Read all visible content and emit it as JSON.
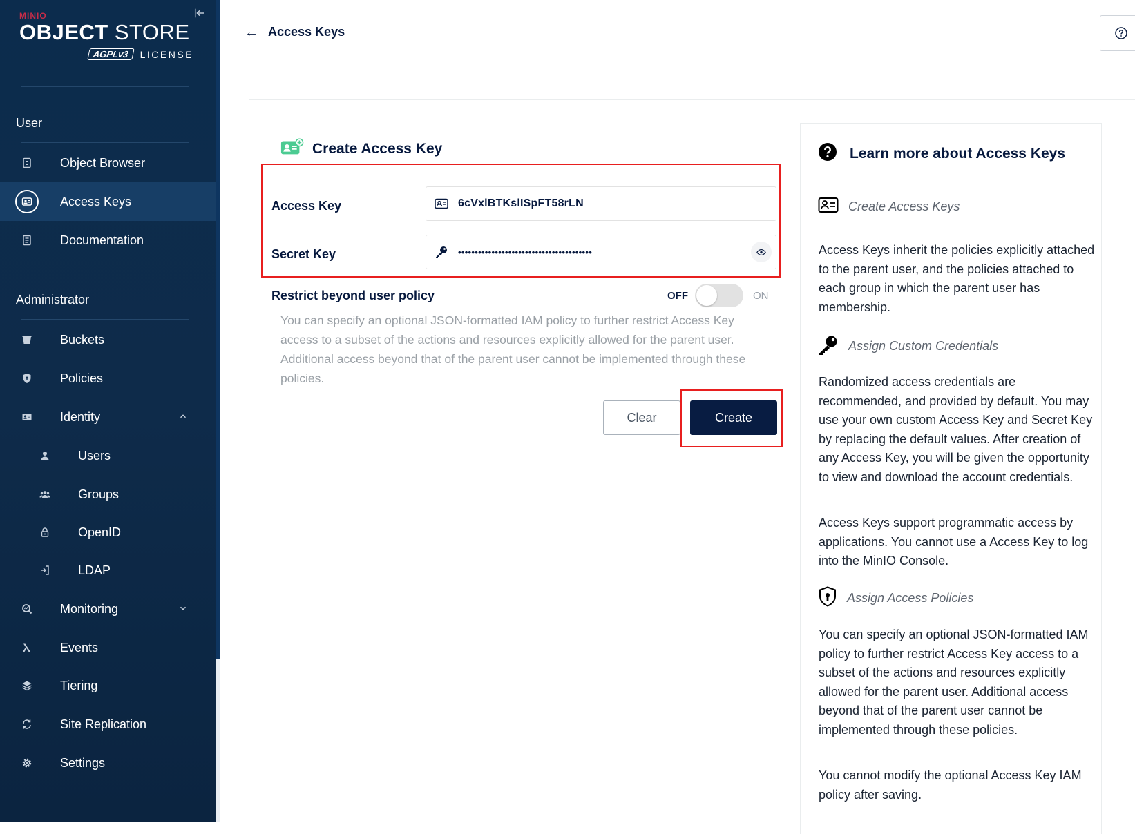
{
  "sidebar": {
    "brand": "MINIO",
    "title_bold": "OBJECT",
    "title_light": " STORE",
    "license_badge": "AGPLv3",
    "license_text": "LICENSE",
    "sections": {
      "user": "User",
      "admin": "Administrator"
    },
    "user_items": [
      {
        "label": "Object Browser",
        "icon": "object-browser-icon"
      },
      {
        "label": "Access Keys",
        "icon": "access-keys-icon",
        "active": true
      },
      {
        "label": "Documentation",
        "icon": "documentation-icon"
      }
    ],
    "admin_items": [
      {
        "label": "Buckets",
        "icon": "buckets-icon"
      },
      {
        "label": "Policies",
        "icon": "policies-icon"
      },
      {
        "label": "Identity",
        "icon": "identity-icon",
        "expanded": true
      },
      {
        "label": "Users",
        "icon": "users-icon"
      },
      {
        "label": "Groups",
        "icon": "groups-icon"
      },
      {
        "label": "OpenID",
        "icon": "openid-icon"
      },
      {
        "label": "LDAP",
        "icon": "ldap-icon"
      },
      {
        "label": "Monitoring",
        "icon": "monitoring-icon",
        "expanded": false
      },
      {
        "label": "Events",
        "icon": "events-icon"
      },
      {
        "label": "Tiering",
        "icon": "tiering-icon"
      },
      {
        "label": "Site Replication",
        "icon": "site-replication-icon"
      },
      {
        "label": "Settings",
        "icon": "settings-icon"
      }
    ]
  },
  "header": {
    "back_arrow": "←",
    "title": "Access Keys"
  },
  "form": {
    "title": "Create Access Key",
    "access_key_label": "Access Key",
    "access_key_value": "6cVxlBTKslISpFT58rLN",
    "secret_key_label": "Secret Key",
    "secret_key_masked": "••••••••••••••••••••••••••••••••••••••••",
    "restrict_label": "Restrict beyond user policy",
    "toggle_off": "OFF",
    "toggle_on": "ON",
    "toggle_state": "off",
    "restrict_description": "You can specify an optional JSON-formatted IAM policy to further restrict Access Key access to a subset of the actions and resources explicitly allowed for the parent user. Additional access beyond that of the parent user cannot be implemented through these policies.",
    "clear_label": "Clear",
    "create_label": "Create"
  },
  "help": {
    "title": "Learn more about Access Keys",
    "sub1": "Create Access Keys",
    "p1": "Access Keys inherit the policies explicitly attached to the parent user, and the policies attached to each group in which the parent user has membership.",
    "sub2": "Assign Custom Credentials",
    "p2": "Randomized access credentials are recommended, and provided by default. You may use your own custom Access Key and Secret Key by replacing the default values. After creation of any Access Key, you will be given the opportunity to view and download the account credentials.",
    "p3": "Access Keys support programmatic access by applications. You cannot use a Access Key to log into the MinIO Console.",
    "sub3": "Assign Access Policies",
    "p4": "You can specify an optional JSON-formatted IAM policy to further restrict Access Key access to a subset of the actions and resources explicitly allowed for the parent user. Additional access beyond that of the parent user cannot be implemented through these policies.",
    "p5": "You cannot modify the optional Access Key IAM policy after saving."
  },
  "colors": {
    "sidebar_bg": "#0c2c4d",
    "sidebar_active": "#173e66",
    "brand_red": "#c72c48",
    "primary_button": "#081c42",
    "highlight_red": "#e81f1f",
    "icon_green": "#4ccb92"
  }
}
